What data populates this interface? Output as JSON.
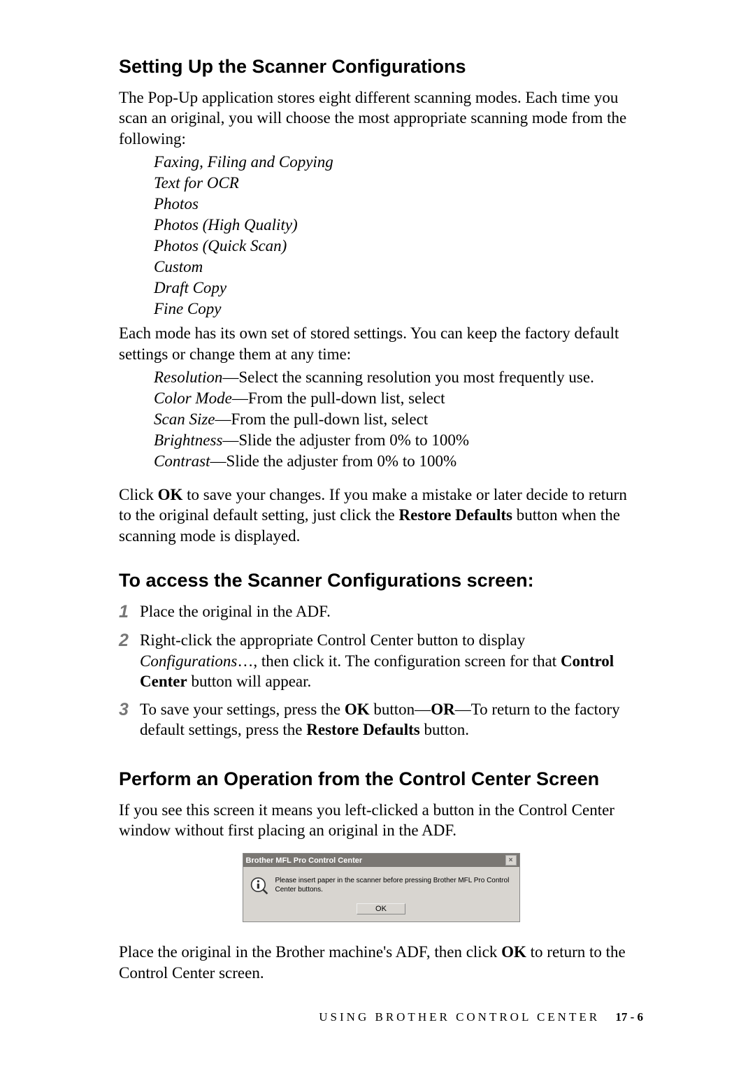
{
  "heading1": "Setting Up the Scanner Configurations",
  "intro1": "The Pop-Up application stores eight different scanning modes. Each time you scan an original, you will choose the most appropriate scanning mode from the following:",
  "modes": [
    "Faxing, Filing and Copying",
    "Text for OCR",
    "Photos",
    "Photos (High Quality)",
    "Photos (Quick Scan)",
    "Custom",
    "Draft Copy",
    "Fine Copy"
  ],
  "intro2": "Each mode has its own set of stored settings. You can keep the factory default settings or change them at any time:",
  "settings": [
    {
      "term": "Resolution",
      "desc": "—Select the scanning resolution you most frequently use."
    },
    {
      "term": "Color Mode",
      "desc": "—From the pull-down list, select"
    },
    {
      "term": "Scan Size",
      "desc": "—From the pull-down list, select"
    },
    {
      "term": "Brightness",
      "desc": "—Slide the adjuster from 0% to 100%"
    },
    {
      "term": "Contrast",
      "desc": "—Slide the adjuster from 0% to 100%"
    }
  ],
  "save_para": {
    "pre": "Click ",
    "ok": "OK",
    "mid": " to save your changes. If you make a mistake or later decide to return to the original default setting, just click the ",
    "rd": "Restore Defaults",
    "post": " button when the scanning mode is displayed."
  },
  "heading2": "To access the Scanner Configurations screen:",
  "steps": {
    "s1": "Place the original in the ADF.",
    "s2": {
      "a": "Right-click the appropriate Control Center button to display ",
      "conf": "Configurations",
      "b": "…, then click it. The configuration screen for that ",
      "cc": "Control Center",
      "c": " button will appear."
    },
    "s3": {
      "a": "To save your settings, press the ",
      "ok": "OK",
      "b": " button—",
      "or": "OR",
      "c": "—To return to the factory default settings, press the ",
      "rd": "Restore Defaults",
      "d": " button."
    }
  },
  "heading3": "Perform an Operation from the Control Center Screen",
  "perform_intro": "If you see this screen it means you left-clicked a button in the Control Center window without first placing an original in the ADF.",
  "dialog": {
    "title": "Brother MFL Pro Control Center",
    "message": "Please insert paper in the scanner before pressing Brother MFL Pro Control Center buttons.",
    "ok_label": "OK",
    "close_glyph": "×"
  },
  "perform_outro": {
    "a": "Place the original in the Brother machine's ADF, then click ",
    "ok": "OK",
    "b": " to return to the Control Center screen."
  },
  "footer": {
    "text": "USING BROTHER CONTROL CENTER",
    "page": "17 - 6"
  }
}
